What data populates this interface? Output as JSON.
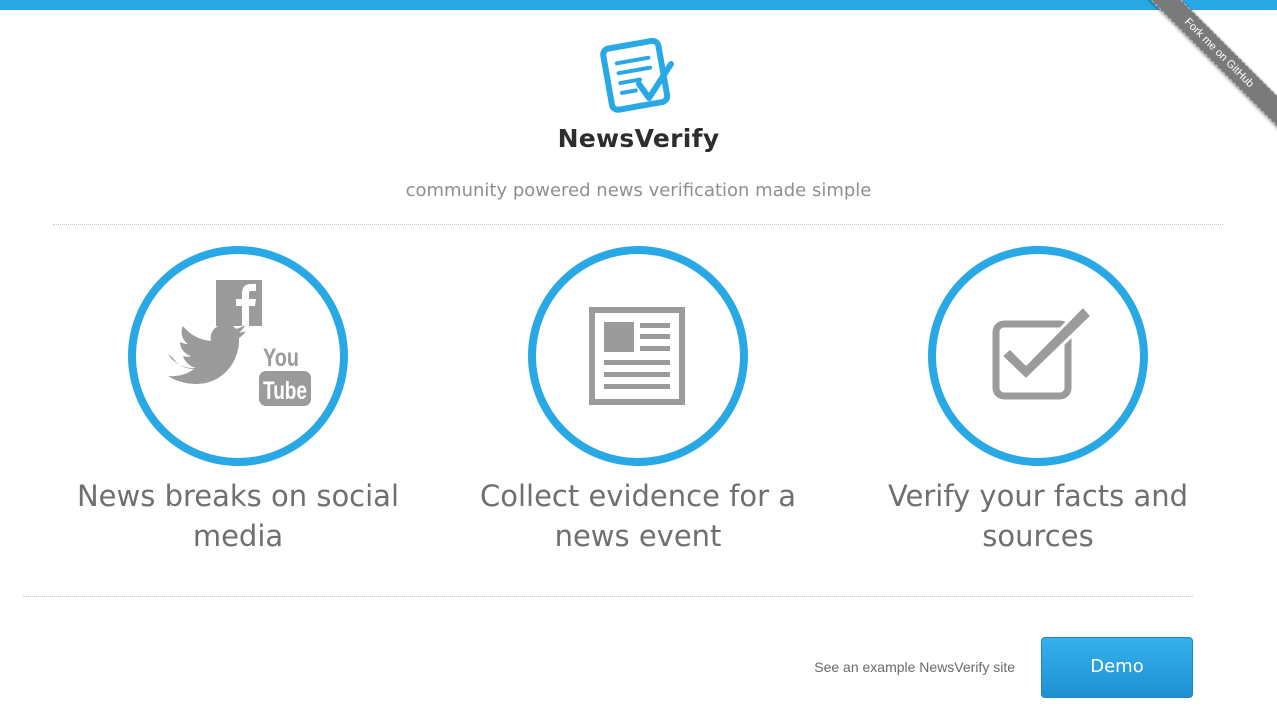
{
  "brand": {
    "name": "NewsVerify",
    "tagline": "community powered news verification made simple"
  },
  "ribbon": {
    "label": "Fork me on GitHub"
  },
  "features": [
    {
      "caption_line1": "News breaks on social",
      "caption_line2": "media",
      "icons": [
        "facebook-icon",
        "twitter-icon",
        "youtube-icon"
      ]
    },
    {
      "caption_line1": "Collect evidence for a",
      "caption_line2": "news event",
      "icons": [
        "newspaper-icon"
      ]
    },
    {
      "caption_line1": "Verify your facts and",
      "caption_line2": "sources",
      "icons": [
        "checkbox-icon"
      ]
    }
  ],
  "youtube_icon": {
    "top": "You",
    "bottom": "Tube"
  },
  "cta": {
    "text": "See an example NewsVerify site",
    "button_label": "Demo"
  },
  "colors": {
    "accent": "#29a8e6",
    "icon_gray": "#9b9b9b",
    "text_dark": "#2d2d2d",
    "text_gray": "#6f6f6f"
  }
}
